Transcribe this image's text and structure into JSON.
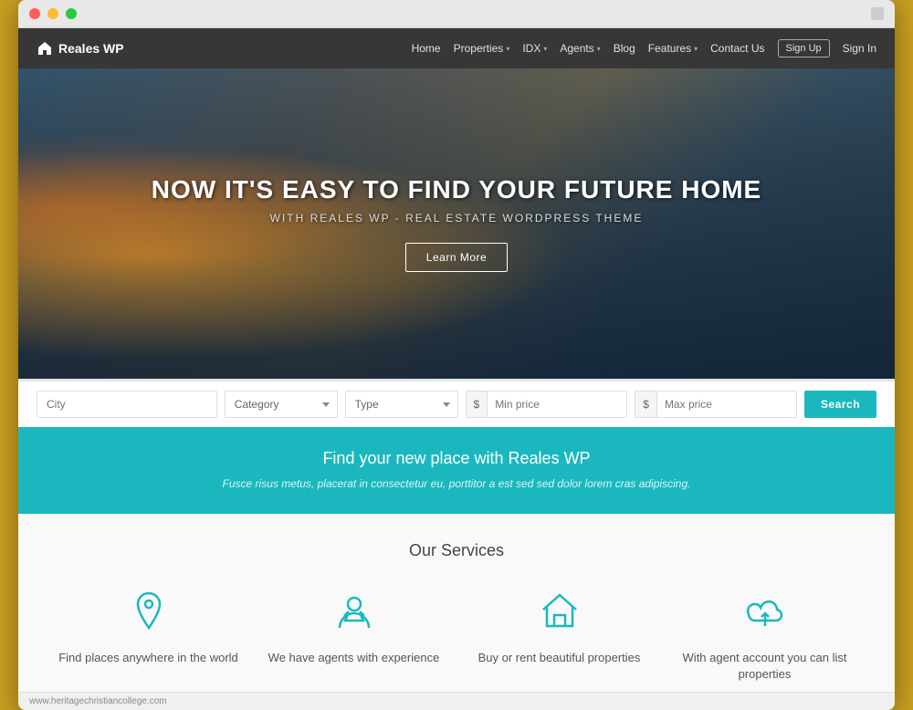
{
  "browser": {
    "status_url": "www.heritagechristiancollege.com"
  },
  "navbar": {
    "brand": "Reales WP",
    "nav_items": [
      {
        "label": "Home",
        "has_dropdown": false
      },
      {
        "label": "Properties",
        "has_dropdown": true
      },
      {
        "label": "IDX",
        "has_dropdown": true
      },
      {
        "label": "Agents",
        "has_dropdown": true
      },
      {
        "label": "Blog",
        "has_dropdown": false
      },
      {
        "label": "Features",
        "has_dropdown": true
      },
      {
        "label": "Contact Us",
        "has_dropdown": false
      }
    ],
    "sign_up": "Sign Up",
    "sign_in": "Sign In"
  },
  "hero": {
    "title": "NOW IT'S EASY TO FIND YOUR FUTURE HOME",
    "subtitle": "WITH REALES WP - REAL ESTATE WORDPRESS THEME",
    "cta_label": "Learn More"
  },
  "search": {
    "city_placeholder": "City",
    "category_label": "Category",
    "type_label": "Type",
    "min_price_placeholder": "Min price",
    "max_price_placeholder": "Max price",
    "currency_symbol": "$",
    "search_button": "Search"
  },
  "teal_banner": {
    "title": "Find your new place with Reales WP",
    "subtitle": "Fusce risus metus, placerat in consectetur eu, porttitor a est sed sed dolor lorem cras adipiscing."
  },
  "services": {
    "section_title": "Our Services",
    "items": [
      {
        "icon": "location-pin",
        "label": "Find places anywhere in the world"
      },
      {
        "icon": "agent-person",
        "label": "We have agents with experience"
      },
      {
        "icon": "house",
        "label": "Buy or rent beautiful properties"
      },
      {
        "icon": "cloud-upload",
        "label": "With agent account you can list properties"
      }
    ]
  }
}
